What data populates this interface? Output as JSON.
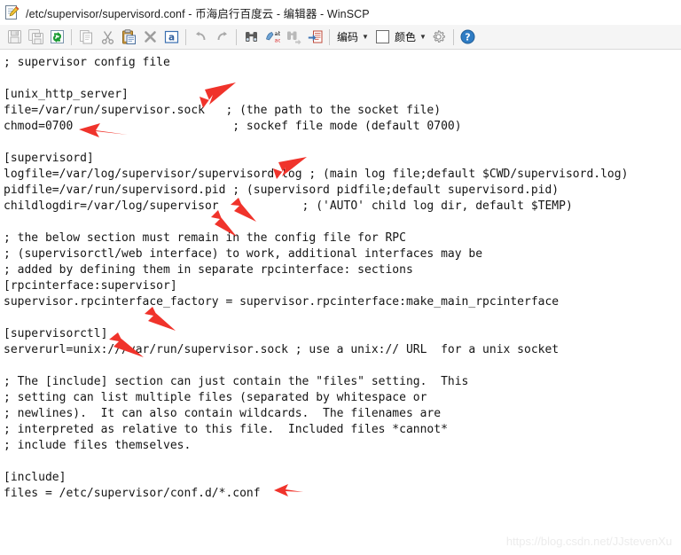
{
  "window": {
    "title": "/etc/supervisor/supervisord.conf - 币海启行百度云 - 编辑器 - WinSCP",
    "icon": "editor-document-pencil-icon"
  },
  "toolbar": {
    "buttons": [
      {
        "name": "save-button",
        "icon": "floppy-disk-icon",
        "enabled": false
      },
      {
        "name": "save-as-button",
        "icon": "floppy-disk-copy-icon",
        "enabled": false
      },
      {
        "name": "reload-button",
        "icon": "reload-arrows-icon",
        "enabled": true
      },
      {
        "name": "copy-button",
        "icon": "copy-pages-icon",
        "enabled": false
      },
      {
        "name": "cut-button",
        "icon": "scissors-icon",
        "enabled": false
      },
      {
        "name": "paste-button",
        "icon": "clipboard-icon",
        "enabled": true
      },
      {
        "name": "delete-button",
        "icon": "cross-x-icon",
        "enabled": false
      },
      {
        "name": "select-all-button",
        "icon": "letter-a-box-icon",
        "enabled": true
      },
      {
        "name": "undo-button",
        "icon": "undo-arrow-icon",
        "enabled": false
      },
      {
        "name": "redo-button",
        "icon": "redo-arrow-icon",
        "enabled": false
      },
      {
        "name": "find-button",
        "icon": "binoculars-icon",
        "enabled": true
      },
      {
        "name": "replace-button",
        "icon": "replace-abc-icon",
        "enabled": true
      },
      {
        "name": "find-next-button",
        "icon": "binoculars-next-icon",
        "enabled": false
      },
      {
        "name": "go-to-line-button",
        "icon": "go-to-line-icon",
        "enabled": true
      }
    ],
    "encoding_label": "编码",
    "color_label": "颜色",
    "color_swatch_value": "#ffffff",
    "caret_glyph": "▼",
    "settings_icon": "gear-icon",
    "help_icon": "help-question-icon"
  },
  "editor": {
    "content": "; supervisor config file\n\n[unix_http_server]\nfile=/var/run/supervisor.sock   ; (the path to the socket file)\nchmod=0700                       ; sockef file mode (default 0700)\n\n[supervisord]\nlogfile=/var/log/supervisor/supervisord.log ; (main log file;default $CWD/supervisord.log)\npidfile=/var/run/supervisord.pid ; (supervisord pidfile;default supervisord.pid)\nchildlogdir=/var/log/supervisor            ; ('AUTO' child log dir, default $TEMP)\n\n; the below section must remain in the config file for RPC\n; (supervisorctl/web interface) to work, additional interfaces may be\n; added by defining them in separate rpcinterface: sections\n[rpcinterface:supervisor]\nsupervisor.rpcinterface_factory = supervisor.rpcinterface:make_main_rpcinterface\n\n[supervisorctl]\nserverurl=unix:///var/run/supervisor.sock ; use a unix:// URL  for a unix socket\n\n; The [include] section can just contain the \"files\" setting.  This\n; setting can list multiple files (separated by whitespace or\n; newlines).  It can also contain wildcards.  The filenames are\n; interpreted as relative to this file.  Included files *cannot*\n; include files themselves.\n\n[include]\nfiles = /etc/supervisor/conf.d/*.conf"
  },
  "annotations": {
    "arrow_color": "#f0332b",
    "arrows": [
      {
        "name": "annotation-arrow-socket-file",
        "target": "file=/var/run/supervisor.sock"
      },
      {
        "name": "annotation-arrow-chmod",
        "target": "chmod=0700"
      },
      {
        "name": "annotation-arrow-logfile",
        "target": "logfile=/var/log/supervisor/supervisord.log"
      },
      {
        "name": "annotation-arrow-pidfile",
        "target": "pidfile=/var/run/supervisord.pid"
      },
      {
        "name": "annotation-arrow-childlogdir",
        "target": "childlogdir=/var/log/supervisor"
      },
      {
        "name": "annotation-arrow-rpcinterface-factory",
        "target": "supervisor.rpcinterface_factory"
      },
      {
        "name": "annotation-arrow-serverurl",
        "target": "serverurl=unix:///var/run/supervisor.sock"
      },
      {
        "name": "annotation-arrow-include-files",
        "target": "files = /etc/supervisor/conf.d/*.conf"
      }
    ]
  },
  "watermark": {
    "text": "https://blog.csdn.net/JJstevenXu"
  }
}
